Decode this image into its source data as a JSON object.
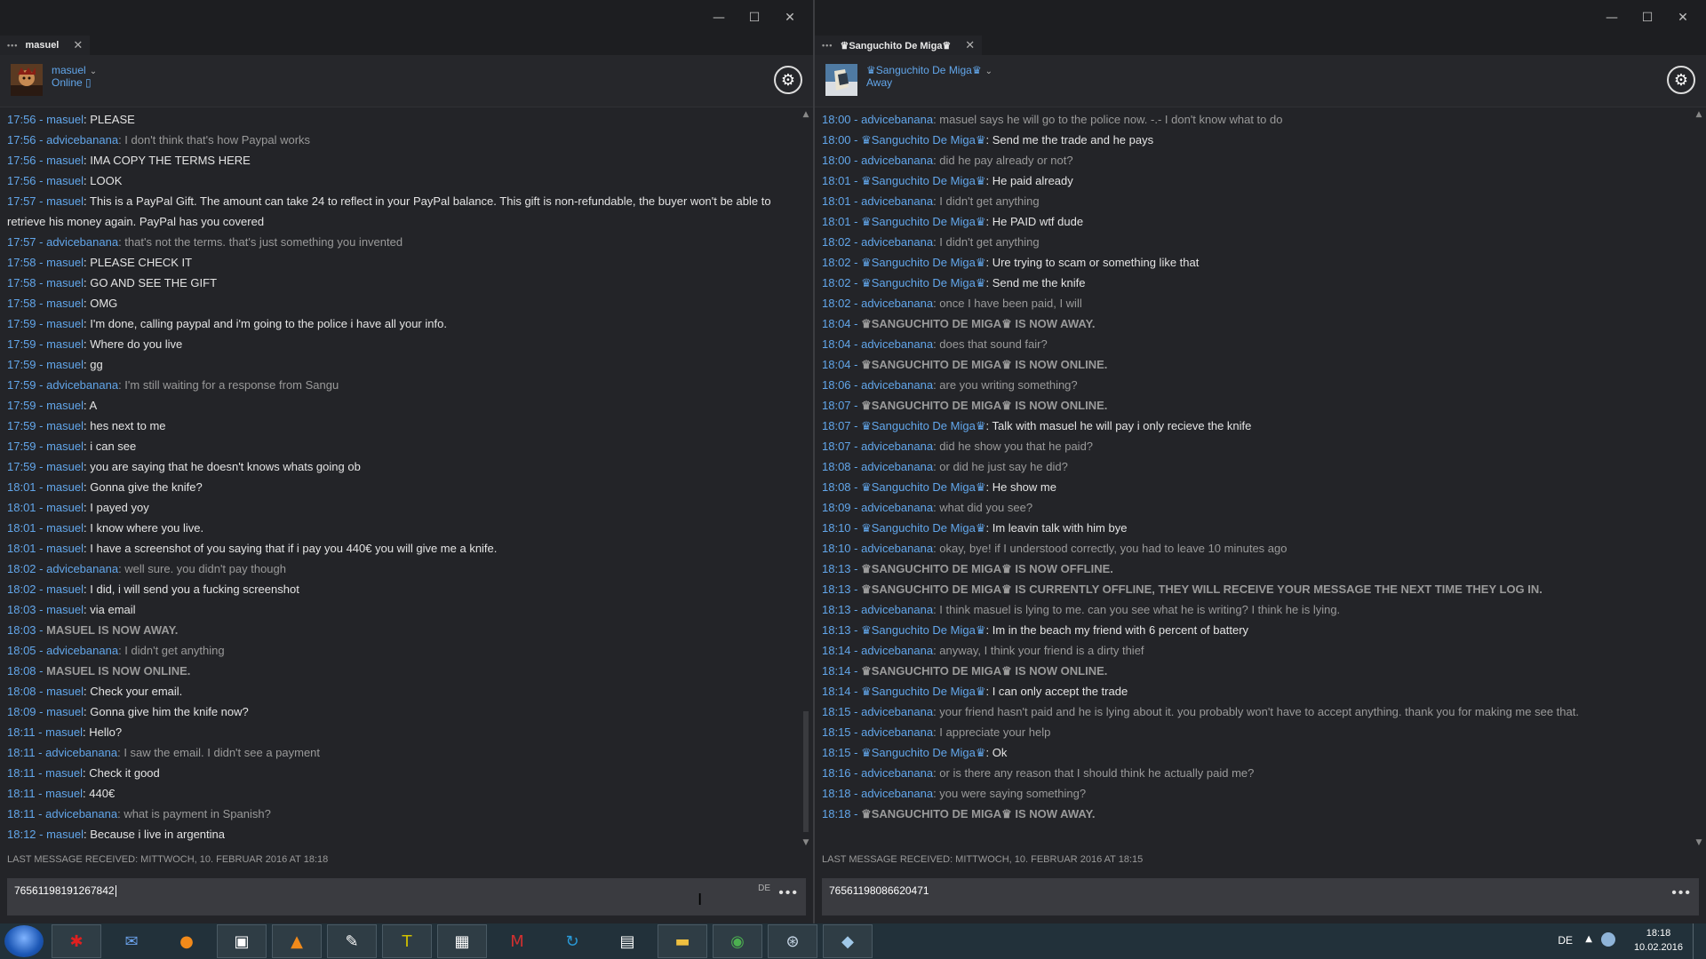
{
  "left_window": {
    "tab_label": "masuel",
    "user": {
      "name": "masuel",
      "status": "Online",
      "status_icon": "phone-icon"
    },
    "messages": [
      {
        "time": "17:56",
        "sender": "masuel",
        "text": "PLEASE",
        "kind": "other"
      },
      {
        "time": "17:56",
        "sender": "advicebanana",
        "text": "I don't think that's how Paypal works",
        "kind": "self"
      },
      {
        "time": "17:56",
        "sender": "masuel",
        "text": "IMA COPY THE TERMS HERE",
        "kind": "other"
      },
      {
        "time": "17:56",
        "sender": "masuel",
        "text": "LOOK",
        "kind": "other"
      },
      {
        "time": "17:57",
        "sender": "masuel",
        "text": "This is a PayPal Gift. The amount can take 24 to reflect in your PayPal balance. This gift is non-refundable, the buyer won't be able to retrieve his money again. PayPal has you covered",
        "kind": "other"
      },
      {
        "time": "17:57",
        "sender": "advicebanana",
        "text": "that's not the terms. that's just something you invented",
        "kind": "self"
      },
      {
        "time": "17:58",
        "sender": "masuel",
        "text": "PLEASE CHECK IT",
        "kind": "other"
      },
      {
        "time": "17:58",
        "sender": "masuel",
        "text": "GO AND SEE THE GIFT",
        "kind": "other"
      },
      {
        "time": "17:58",
        "sender": "masuel",
        "text": "OMG",
        "kind": "other"
      },
      {
        "time": "17:59",
        "sender": "masuel",
        "text": "I'm done, calling paypal and i'm going to the police i have all your info.",
        "kind": "other"
      },
      {
        "time": "17:59",
        "sender": "masuel",
        "text": "Where do you live",
        "kind": "other"
      },
      {
        "time": "17:59",
        "sender": "masuel",
        "text": "gg",
        "kind": "other"
      },
      {
        "time": "17:59",
        "sender": "advicebanana",
        "text": "I'm still waiting for a response from Sangu",
        "kind": "self"
      },
      {
        "time": "17:59",
        "sender": "masuel",
        "text": "A",
        "kind": "other"
      },
      {
        "time": "17:59",
        "sender": "masuel",
        "text": "hes next to me",
        "kind": "other"
      },
      {
        "time": "17:59",
        "sender": "masuel",
        "text": "i can see",
        "kind": "other"
      },
      {
        "time": "17:59",
        "sender": "masuel",
        "text": "you are saying that he doesn't knows whats going ob",
        "kind": "other"
      },
      {
        "time": "18:01",
        "sender": "masuel",
        "text": "Gonna give the knife?",
        "kind": "other"
      },
      {
        "time": "18:01",
        "sender": "masuel",
        "text": "I payed yoy",
        "kind": "other"
      },
      {
        "time": "18:01",
        "sender": "masuel",
        "text": "I know where you live.",
        "kind": "other"
      },
      {
        "time": "18:01",
        "sender": "masuel",
        "text": "I have a screenshot of you saying that if i pay you 440€ you will give me a knife.",
        "kind": "other"
      },
      {
        "time": "18:02",
        "sender": "advicebanana",
        "text": "well sure. you didn't pay though",
        "kind": "self"
      },
      {
        "time": "18:02",
        "sender": "masuel",
        "text": "I did, i will send you a fucking screenshot",
        "kind": "other"
      },
      {
        "time": "18:03",
        "sender": "masuel",
        "text": "via email",
        "kind": "other"
      },
      {
        "time": "18:03",
        "sender": "",
        "text": "MASUEL IS NOW AWAY.",
        "kind": "sys"
      },
      {
        "time": "18:05",
        "sender": "advicebanana",
        "text": "I didn't get anything",
        "kind": "self"
      },
      {
        "time": "18:08",
        "sender": "",
        "text": "MASUEL IS NOW ONLINE.",
        "kind": "sys"
      },
      {
        "time": "18:08",
        "sender": "masuel",
        "text": "Check your email.",
        "kind": "other"
      },
      {
        "time": "18:09",
        "sender": "masuel",
        "text": "Gonna give him the knife now?",
        "kind": "other"
      },
      {
        "time": "18:11",
        "sender": "masuel",
        "text": "Hello?",
        "kind": "other"
      },
      {
        "time": "18:11",
        "sender": "advicebanana",
        "text": "I saw the email. I didn't see a payment",
        "kind": "self"
      },
      {
        "time": "18:11",
        "sender": "masuel",
        "text": "Check it good",
        "kind": "other"
      },
      {
        "time": "18:11",
        "sender": "masuel",
        "text": "440€",
        "kind": "other"
      },
      {
        "time": "18:11",
        "sender": "advicebanana",
        "text": "what is payment in Spanish?",
        "kind": "self"
      },
      {
        "time": "18:12",
        "sender": "masuel",
        "text": "Because i live in argentina",
        "kind": "other"
      }
    ],
    "last_message": "LAST MESSAGE RECEIVED: MITTWOCH, 10. FEBRUAR 2016 AT 18:18",
    "input_value": "76561198191267842",
    "input_lang": "DE"
  },
  "right_window": {
    "tab_label": "♛Sanguchito De Miga♛",
    "user": {
      "name": "♛Sanguchito De Miga♛",
      "status": "Away"
    },
    "messages": [
      {
        "time": "18:00",
        "sender": "advicebanana",
        "text": "masuel says he will go to the police now. -.- I don't know what to do",
        "kind": "self"
      },
      {
        "time": "18:00",
        "sender": "♛Sanguchito De Miga♛",
        "text": "Send me the trade and he pays",
        "kind": "other"
      },
      {
        "time": "18:00",
        "sender": "advicebanana",
        "text": "did he pay already or not?",
        "kind": "self"
      },
      {
        "time": "18:01",
        "sender": "♛Sanguchito De Miga♛",
        "text": "He paid already",
        "kind": "other"
      },
      {
        "time": "18:01",
        "sender": "advicebanana",
        "text": "I didn't get anything",
        "kind": "self"
      },
      {
        "time": "18:01",
        "sender": "♛Sanguchito De Miga♛",
        "text": "He PAID wtf dude",
        "kind": "other"
      },
      {
        "time": "18:02",
        "sender": "advicebanana",
        "text": "I didn't get anything",
        "kind": "self"
      },
      {
        "time": "18:02",
        "sender": "♛Sanguchito De Miga♛",
        "text": "Ure trying to scam or something like that",
        "kind": "other"
      },
      {
        "time": "18:02",
        "sender": "♛Sanguchito De Miga♛",
        "text": "Send me the knife",
        "kind": "other"
      },
      {
        "time": "18:02",
        "sender": "advicebanana",
        "text": "once I have been paid, I will",
        "kind": "self"
      },
      {
        "time": "18:04",
        "sender": "",
        "text": "♛SANGUCHITO DE MIGA♛ IS NOW AWAY.",
        "kind": "sys"
      },
      {
        "time": "18:04",
        "sender": "advicebanana",
        "text": "does that sound fair?",
        "kind": "self"
      },
      {
        "time": "18:04",
        "sender": "",
        "text": "♛SANGUCHITO DE MIGA♛ IS NOW ONLINE.",
        "kind": "sys"
      },
      {
        "time": "18:06",
        "sender": "advicebanana",
        "text": "are you writing something?",
        "kind": "self"
      },
      {
        "time": "18:07",
        "sender": "",
        "text": "♛SANGUCHITO DE MIGA♛ IS NOW ONLINE.",
        "kind": "sys"
      },
      {
        "time": "18:07",
        "sender": "♛Sanguchito De Miga♛",
        "text": "Talk with masuel he will pay i only recieve the knife",
        "kind": "other"
      },
      {
        "time": "18:07",
        "sender": "advicebanana",
        "text": "did he show you that he paid?",
        "kind": "self"
      },
      {
        "time": "18:08",
        "sender": "advicebanana",
        "text": "or did he just say he did?",
        "kind": "self"
      },
      {
        "time": "18:08",
        "sender": "♛Sanguchito De Miga♛",
        "text": "He show me",
        "kind": "other"
      },
      {
        "time": "18:09",
        "sender": "advicebanana",
        "text": "what did you see?",
        "kind": "self"
      },
      {
        "time": "18:10",
        "sender": "♛Sanguchito De Miga♛",
        "text": "Im leavin talk with him bye",
        "kind": "other"
      },
      {
        "time": "18:10",
        "sender": "advicebanana",
        "text": "okay, bye! if I understood correctly, you had to leave 10 minutes ago",
        "kind": "self"
      },
      {
        "time": "18:13",
        "sender": "",
        "text": "♛SANGUCHITO DE MIGA♛ IS NOW OFFLINE.",
        "kind": "sys"
      },
      {
        "time": "18:13",
        "sender": "",
        "text": "♛SANGUCHITO DE MIGA♛ IS CURRENTLY OFFLINE, THEY WILL RECEIVE YOUR MESSAGE THE NEXT TIME THEY LOG IN.",
        "kind": "sys"
      },
      {
        "time": "18:13",
        "sender": "advicebanana",
        "text": "I think masuel is lying to me. can you see what he is writing? I think he is lying.",
        "kind": "self"
      },
      {
        "time": "18:13",
        "sender": "♛Sanguchito De Miga♛",
        "text": "Im in the beach my friend with 6 percent of battery",
        "kind": "other"
      },
      {
        "time": "18:14",
        "sender": "advicebanana",
        "text": "anyway, I think your friend is a dirty thief",
        "kind": "self"
      },
      {
        "time": "18:14",
        "sender": "",
        "text": "♛SANGUCHITO DE MIGA♛ IS NOW ONLINE.",
        "kind": "sys"
      },
      {
        "time": "18:14",
        "sender": "♛Sanguchito De Miga♛",
        "text": "I can only accept the trade",
        "kind": "other"
      },
      {
        "time": "18:15",
        "sender": "advicebanana",
        "text": "your friend hasn't paid and he is lying about it. you probably won't have to accept anything. thank you for making me see that.",
        "kind": "self"
      },
      {
        "time": "18:15",
        "sender": "advicebanana",
        "text": "I appreciate your help",
        "kind": "self"
      },
      {
        "time": "18:15",
        "sender": "♛Sanguchito De Miga♛",
        "text": "Ok",
        "kind": "other"
      },
      {
        "time": "18:16",
        "sender": "advicebanana",
        "text": "or is there any reason that I should think he actually paid me?",
        "kind": "self"
      },
      {
        "time": "18:18",
        "sender": "advicebanana",
        "text": "you were saying something?",
        "kind": "self"
      },
      {
        "time": "18:18",
        "sender": "",
        "text": "♛SANGUCHITO DE MIGA♛ IS NOW AWAY.",
        "kind": "sys"
      }
    ],
    "last_message": "LAST MESSAGE RECEIVED: MITTWOCH, 10. FEBRUAR 2016 AT 18:15",
    "input_value": "76561198086620471"
  },
  "window_controls": {
    "minimize": "—",
    "maximize": "☐",
    "close": "✕",
    "tab_close": "✕",
    "tab_dots": "•••"
  },
  "taskbar": {
    "apps": [
      "windows-start",
      "red-app",
      "thunderbird",
      "firefox",
      "command-prompt",
      "vlc",
      "notepad",
      "texworks",
      "calligraphy-app",
      "gmail-notifier",
      "sync-app",
      "calculator",
      "file-explorer",
      "chrome",
      "steam",
      "generic-app"
    ],
    "language": "DE",
    "time": "18:18",
    "date": "10.02.2016"
  },
  "colors": {
    "name_blue": "#62a6ea",
    "text_other": "#e4e4e4",
    "text_self": "#9a9a9a",
    "bg": "#232428"
  }
}
